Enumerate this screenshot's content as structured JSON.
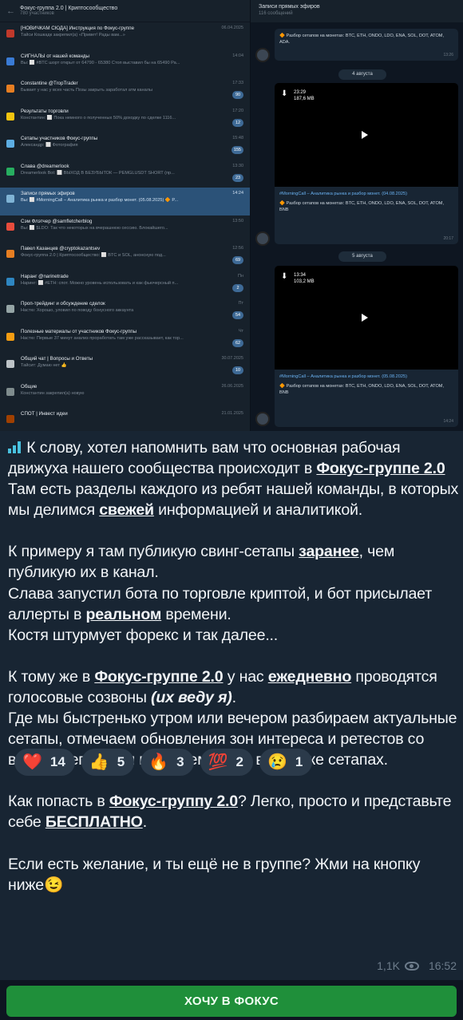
{
  "screenshot": {
    "chats_header": {
      "title": "Фокус-группа 2.0 | Криптосообщество",
      "subtitle": "780 участников"
    },
    "chats": [
      {
        "name": "[НОВИЧКАМ СЮДА] Инструкция по Фокус-группе",
        "preview": "Тайси Кошкадк закрепил(а) «Привет! Рады вам...»",
        "time": "06.04.2025",
        "badge": "",
        "color": "#c0392b"
      },
      {
        "name": "СИГНАЛЫ от нашей команды",
        "preview": "Вы: ⬜ #BTC шорт открыт от 64790 - 65380 Стоп выставил бы на 65490 Ра...",
        "time": "14:04",
        "badge": "",
        "color": "#3a7bd5"
      },
      {
        "name": "Constantine @TropTrader",
        "preview": "Бывает у нас у всех часть Позы закрыть заработал атм каналы",
        "time": "17:33",
        "badge": "90",
        "color": "#e67e22"
      },
      {
        "name": "Результаты торговли",
        "preview": "Константин: ⬜ Пока немного о полученных 50% доходку по сделке 1116...",
        "time": "17:20",
        "badge": "12",
        "color": "#f1c40f"
      },
      {
        "name": "Сетапы участников Фокус-группы",
        "preview": "Александр: ⬜ Фотография",
        "time": "15:48",
        "badge": "155",
        "color": "#5dade2"
      },
      {
        "name": "Слава @dreamerlook",
        "preview": "Dreamerlook Bot: ⬜ ВЫХОД В БЕЗУБЫТОК — PEMGLUSDT SHORT (пр...",
        "time": "13:30",
        "badge": "23",
        "color": "#27ae60"
      },
      {
        "name": "Записи прямых эфиров",
        "preview": "Вы: ⬜ #MorningCall – Аналитика рынка и разбор монет. (05.08.2025) 🔶 P...",
        "time": "14:24",
        "badge": "",
        "color": "#7fb3d5"
      },
      {
        "name": "Сэм Флэтчер @samfletcherblog",
        "preview": "Вы: ⬜ $LDO: Так что некоторых на вчерашнюю сессию. Блокайшего...",
        "time": "13:50",
        "badge": "",
        "color": "#e74c3c"
      },
      {
        "name": "Павел Казанцев @cryptokazantsev",
        "preview": "Фокус-группа 2.0 | Криптосообщество: ⬜ BTC и SOL, анонсную под...",
        "time": "12:56",
        "badge": "69",
        "color": "#e67e22"
      },
      {
        "name": "Наранг @narinetrade",
        "preview": "Наринг: ⬜ #ETH: спот. Можно уровень использовать и как фьючерсный п...",
        "time": "Пн",
        "badge": "2",
        "color": "#2e86c1"
      },
      {
        "name": "Проп-трейдинг и обсуждение сделок",
        "preview": "Настю: Хорошо, уловил по поводу бонусного аккаунта",
        "time": "Пт",
        "badge": "54",
        "color": "#95a5a6"
      },
      {
        "name": "Полезные материалы от участников Фокус-группы",
        "preview": "Настю: Первые 37 минут анализ проработать там уже рассказывает, как тор...",
        "time": "Чт",
        "badge": "62",
        "color": "#f39c12"
      },
      {
        "name": "Общий чат | Вопросы и Ответы",
        "preview": "Тайсит: Думаю нет 👍",
        "time": "30.07.2025",
        "badge": "10",
        "color": "#bdc3c7"
      },
      {
        "name": "Общие",
        "preview": "Константин закрепил(а) новую",
        "time": "26.06.2025",
        "badge": "",
        "color": "#7f8c8d"
      },
      {
        "name": "СПОТ | Инвест идеи",
        "preview": "",
        "time": "21.01.2025",
        "badge": "",
        "color": "#a04000"
      }
    ],
    "channel_header": {
      "title": "Записи прямых эфиров",
      "subtitle": "116 сообщений"
    },
    "channel_top_text": "🔶 Разбор сетапов на монетах: BTC, ETH, ONDO, LDO, ENA, SOL, DOT, ATOM, ADA.",
    "channel_top_time": "13:26",
    "date1": "4 августа",
    "video1": {
      "time": "23:29",
      "size": "187,6 MB"
    },
    "video1_caption": "#MorningCall – Аналитика рынка и разбор монет. (04.08.2025)",
    "video1_caption2": "🔶 Разбор сетапов на монетах: BTC, ETH, ONDO, LDO, ENA, SOL, DOT, ATOM, BNB",
    "video1_time": "20:17",
    "date2": "5 августа",
    "video2": {
      "time": "13:34",
      "size": "103,2 MB"
    },
    "video2_caption": "#MorningCall – Аналитика рынка и разбор монет. (05.08.2025)",
    "video2_caption2": "🔶 Разбор сетапов на монетах: BTC, ETH, ONDO, LDO, ENA, SOL, DOT, ATOM, BNB",
    "video2_time": "14:24"
  },
  "post": {
    "p1_a": "К слову, хотел напомнить вам что основная рабочая движуха нашего сообщества происходит в ",
    "p1_link": "Фокус-группе 2.0",
    "p1_b": "Там есть разделы каждого из ребят нашей команды, в которых мы делимся ",
    "p1_u": "свежей",
    "p1_c": " информацией и аналитикой.",
    "p2_a": "К примеру я там публикую свинг-сетапы ",
    "p2_u": "заранее",
    "p2_b": ", чем публикую их в канал.",
    "p2_c": "Слава запустил бота по торговле криптой, и бот присылает аллерты в ",
    "p2_u2": "реальном",
    "p2_d": " времени.",
    "p2_e": "Костя штурмует форекс и так далее...",
    "p3_a": "К тому же в ",
    "p3_link": "Фокус-группе 2.0",
    "p3_b": " у нас ",
    "p3_u": "ежедневно",
    "p3_c": " проводятся голосовые созвоны ",
    "p3_i": "(их веду я)",
    "p3_d": ".",
    "p3_e": "Где мы быстренько утром или вечером разбираем актуальные сетапы, отмечаем обновления зон интереса и ретестов со вчерашнего дня и помогаем вам в ваших же сетапах.",
    "p4_a": "Как попасть в ",
    "p4_link": "Фокус-группу 2.0",
    "p4_b": "? Легко, просто и представьте себе ",
    "p4_u": "БЕСПЛАТНО",
    "p4_c": ".",
    "p5": "Если есть желание, и ты ещё не в группе? Жми на кнопку ниже😉"
  },
  "reactions": [
    {
      "emoji": "❤️",
      "count": "14"
    },
    {
      "emoji": "👍",
      "count": "5"
    },
    {
      "emoji": "🔥",
      "count": "3"
    },
    {
      "emoji": "💯",
      "count": "2"
    },
    {
      "emoji": "😢",
      "count": "1"
    }
  ],
  "views": "1,1K",
  "time": "16:52",
  "button_label": "ХОЧУ В ФОКУС"
}
